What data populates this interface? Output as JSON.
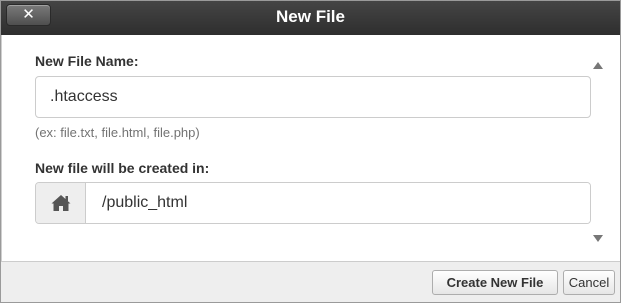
{
  "dialog": {
    "title": "New File",
    "close_label": "✕"
  },
  "form": {
    "filename_label": "New File Name:",
    "filename_value": ".htaccess",
    "hint": "(ex: file.txt, file.html, file.php)",
    "directory_label": "New file will be created in:",
    "directory_value": "/public_html",
    "directory_icon": "home-icon"
  },
  "footer": {
    "create_label": "Create New File",
    "cancel_label": "Cancel"
  },
  "colors": {
    "titlebar": "#333333",
    "title_text": "#ffffff",
    "footer_bg": "#eeeeee"
  }
}
